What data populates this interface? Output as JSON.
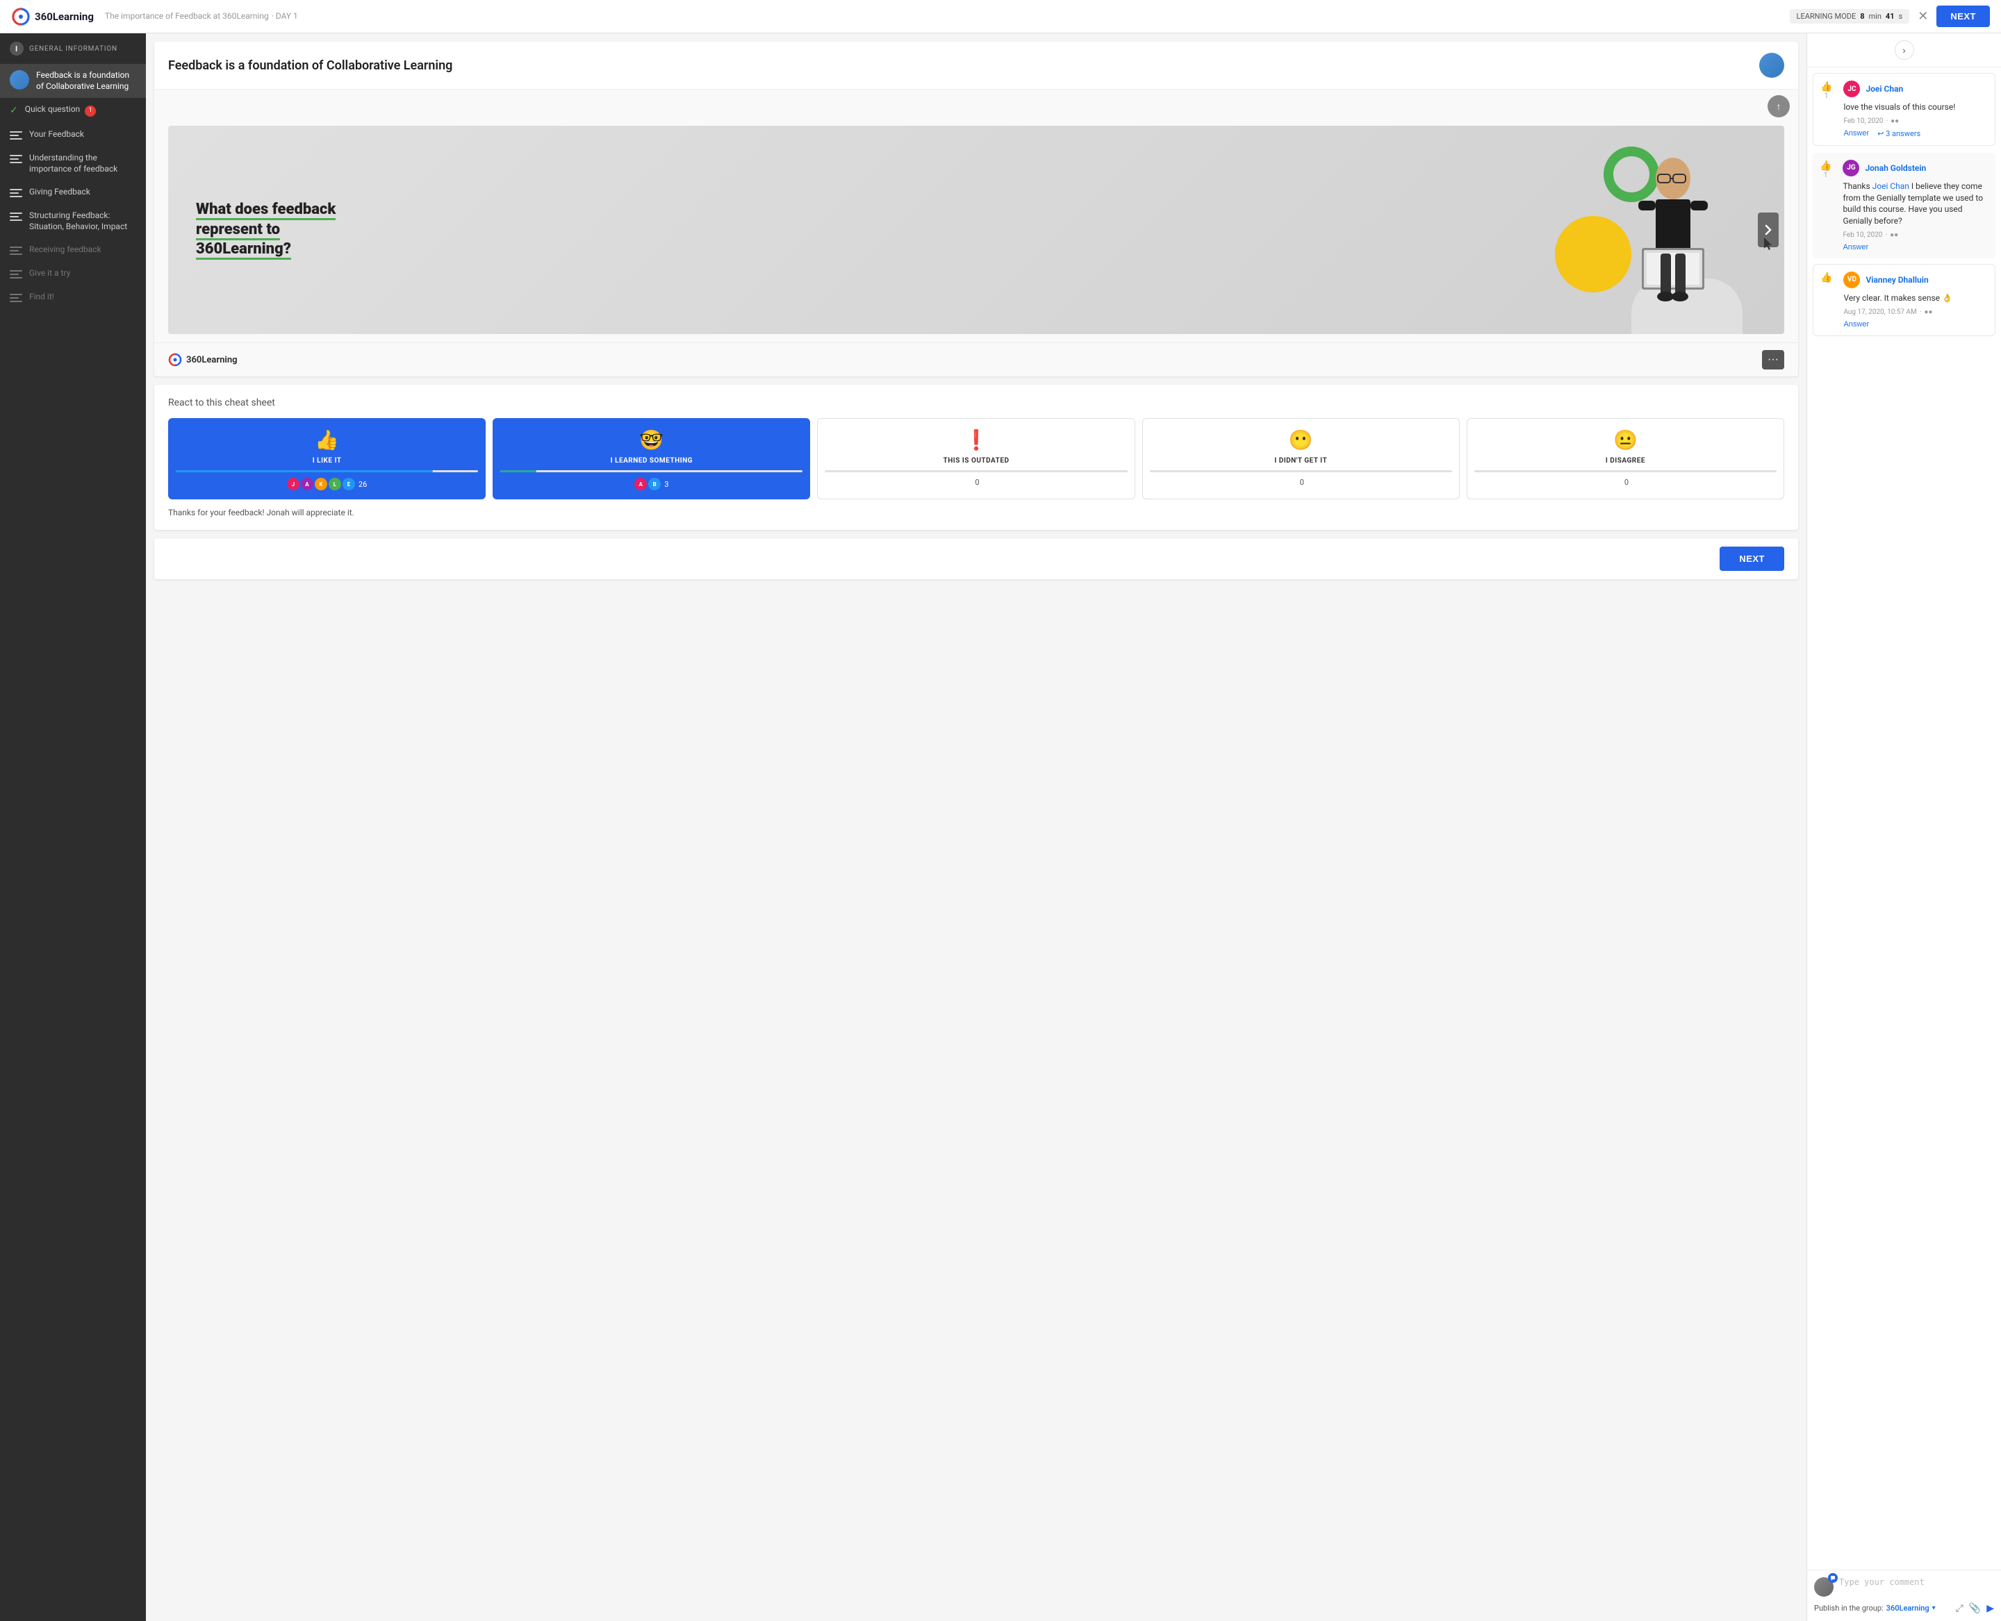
{
  "topbar": {
    "logo_text": "360Learning",
    "title": "The importance of Feedback at 360Learning",
    "day_label": "· DAY 1",
    "learning_mode_label": "LEARNING MODE",
    "time_min": "8",
    "time_min_label": "min",
    "time_sec": "41",
    "time_sec_label": "s",
    "close_title": "Close",
    "next_label": "NEXT"
  },
  "sidebar": {
    "general_info_label": "GENERAL INFORMATION",
    "items": [
      {
        "id": "collaborative-learning",
        "label": "Feedback is a foundation of Collaborative Learning",
        "type": "avatar",
        "active": true
      },
      {
        "id": "quick-question",
        "label": "Quick question",
        "type": "check",
        "badge": "1"
      },
      {
        "id": "your-feedback",
        "label": "Your Feedback",
        "type": "list"
      },
      {
        "id": "understanding",
        "label": "Understanding the importance of feedback",
        "type": "list"
      },
      {
        "id": "giving-feedback",
        "label": "Giving Feedback",
        "type": "list"
      },
      {
        "id": "structuring",
        "label": "Structuring Feedback: Situation, Behavior, Impact",
        "type": "list"
      },
      {
        "id": "receiving-feedback",
        "label": "Receiving feedback",
        "type": "list",
        "disabled": true
      },
      {
        "id": "give-it",
        "label": "Give it a try",
        "type": "list",
        "disabled": true
      },
      {
        "id": "find-it",
        "label": "Find it!",
        "type": "list",
        "disabled": true
      }
    ]
  },
  "slide": {
    "title": "Feedback is a foundation of Collaborative Learning",
    "question": "What does feedback represent to 360Learning?",
    "logo_text": "360Learning"
  },
  "reactions": {
    "title": "React to this cheat sheet",
    "cards": [
      {
        "id": "like",
        "emoji": "👍",
        "label": "I LIKE IT",
        "count": 26,
        "selected": true,
        "bar_pct": 85
      },
      {
        "id": "learned",
        "emoji": "🤓",
        "label": "I LEARNED SOMETHING",
        "count": 3,
        "selected": true,
        "bar_pct": 12
      },
      {
        "id": "outdated",
        "emoji": "❗",
        "label": "THIS IS OUTDATED",
        "count": 0,
        "selected": false,
        "bar_pct": 0
      },
      {
        "id": "didnt-get",
        "emoji": "😶",
        "label": "I DIDN'T GET IT",
        "count": 0,
        "selected": false,
        "bar_pct": 0
      },
      {
        "id": "disagree",
        "emoji": "😐",
        "label": "I DISAGREE",
        "count": 0,
        "selected": false,
        "bar_pct": 0
      }
    ],
    "thanks_text": "Thanks for your feedback! Jonah will appreciate it."
  },
  "comments": {
    "items": [
      {
        "id": "joei-chan",
        "author": "Joei Chan",
        "avatar_color": "#e91e63",
        "avatar_initials": "JC",
        "body": "love the visuals of this course!",
        "date": "Feb 10, 2020",
        "like_count": 1,
        "answers_label": "3 answers",
        "answers": [
          {
            "id": "jonah",
            "author": "Jonah Goldstein",
            "avatar_color": "#9c27b0",
            "avatar_initials": "JG",
            "body": "Thanks Joei Chan I believe they come from the Genially template we used to build this course. Have you used Genially before?",
            "date": "Feb 10, 2020",
            "like_count": 1
          }
        ]
      },
      {
        "id": "vianney",
        "author": "Vianney Dhalluin",
        "avatar_color": "#ff9800",
        "avatar_initials": "VD",
        "body": "Very clear. It makes sense 👌",
        "date": "Aug 17, 2020, 10:57 AM",
        "like_count": 0,
        "answers_label": ""
      }
    ],
    "input_placeholder": "Type your comment",
    "publish_label": "Publish in the group:",
    "publish_group": "360Learning",
    "answer_label": "Answer"
  },
  "next_label": "NEXT"
}
